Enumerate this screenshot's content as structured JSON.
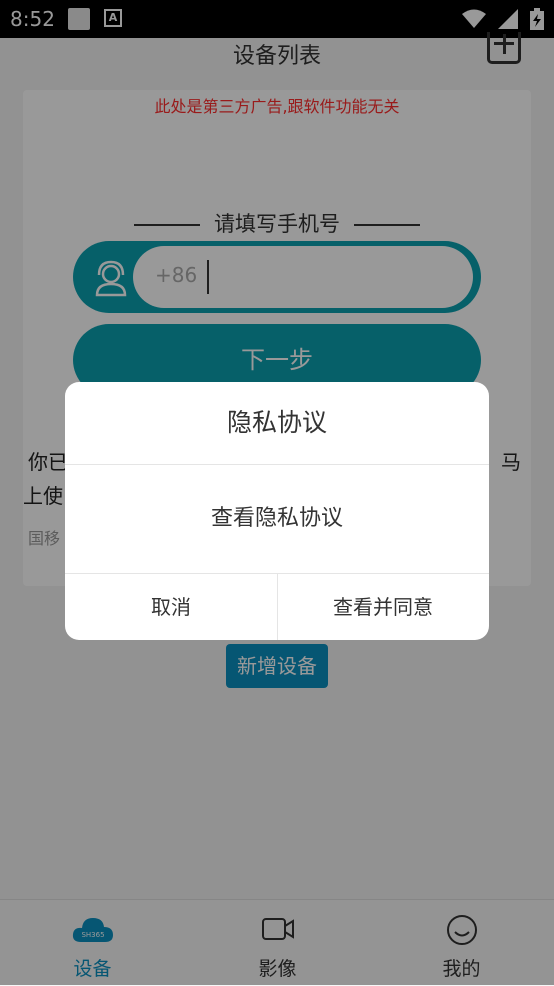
{
  "status_bar": {
    "time": "8:52",
    "a_icon": "A"
  },
  "header": {
    "title": "设备列表"
  },
  "ad_notice": "此处是第三方广告,跟软件功能无关",
  "login": {
    "section_title": "请填写手机号",
    "country_code": "+86",
    "phone_value": "",
    "next_label": "下一步"
  },
  "agreement_text": {
    "line1": "你已",
    "line2": "上使",
    "line3": "国移",
    "comma": "，马"
  },
  "add_device_label": "新增设备",
  "tabs": [
    {
      "label": "设备",
      "icon": "cloud-icon",
      "active": true,
      "badge": "SH365"
    },
    {
      "label": "影像",
      "icon": "video-camera-icon",
      "active": false
    },
    {
      "label": "我的",
      "icon": "smiley-icon",
      "active": false
    }
  ],
  "dialog": {
    "title": "隐私协议",
    "link_label": "查看隐私协议",
    "cancel_label": "取消",
    "agree_label": "查看并同意"
  },
  "colors": {
    "accent": "#0aa0b0",
    "tab_active": "#0a8fc0",
    "ad_red": "#ff2d2d"
  }
}
